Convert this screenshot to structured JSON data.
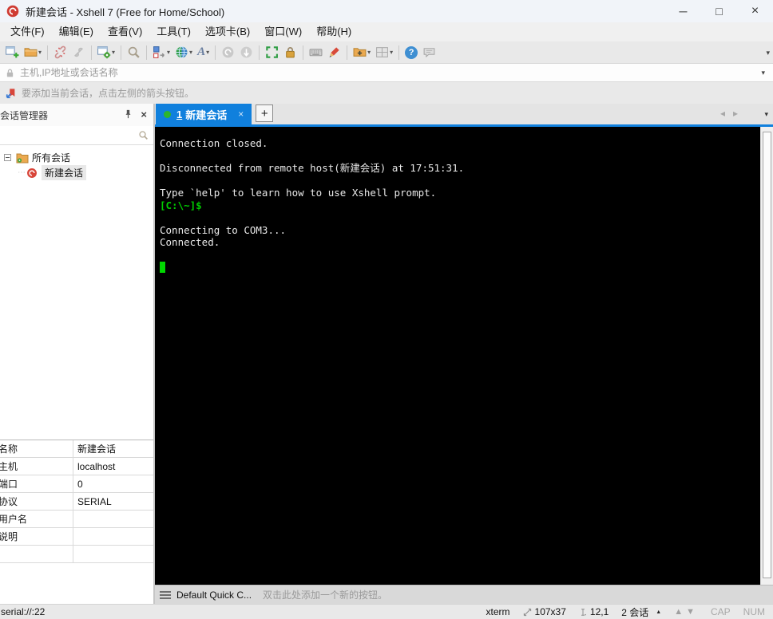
{
  "window": {
    "title": "新建会话 - Xshell 7 (Free for Home/School)",
    "controls": {
      "minimize": "─",
      "maximize": "□",
      "close": "×"
    }
  },
  "menu_bar": {
    "items": [
      "文件(F)",
      "编辑(E)",
      "查看(V)",
      "工具(T)",
      "选项卡(B)",
      "窗口(W)",
      "帮助(H)"
    ]
  },
  "toolbar": {
    "icons": [
      "new-session",
      "open-folder",
      "disconnect",
      "reconnect",
      "session-properties",
      "find",
      "compose",
      "web-browser",
      "font",
      "xshell",
      "xftp",
      "fullscreen",
      "lock-screen",
      "virtual-keyboard",
      "highlight",
      "new-session-folder",
      "tile-windows",
      "help",
      "feedback"
    ]
  },
  "address_bar": {
    "placeholder": "主机,IP地址或会话名称"
  },
  "info_bar": {
    "message": "要添加当前会话，点击左侧的箭头按钮。"
  },
  "session_manager": {
    "title": "会话管理器",
    "all_sessions_label": "所有会话",
    "session_label": "新建会话",
    "properties": [
      {
        "label": "名称",
        "value": "新建会话"
      },
      {
        "label": "主机",
        "value": "localhost"
      },
      {
        "label": "端口",
        "value": "0"
      },
      {
        "label": "协议",
        "value": "SERIAL"
      },
      {
        "label": "用户名",
        "value": ""
      },
      {
        "label": "说明",
        "value": ""
      }
    ]
  },
  "tab_bar": {
    "active_tab": {
      "number": "1",
      "label": "新建会话",
      "close": "×"
    },
    "new_tab_label": "+"
  },
  "terminal": {
    "background": "#000000",
    "text_color": "#e9e9e9",
    "prompt_color": "#00cc00",
    "cursor_color": "#00d800",
    "lines": [
      "Connection closed.",
      "",
      "Disconnected from remote host(新建会话) at 17:51:31.",
      "",
      "Type `help' to learn how to use Xshell prompt.",
      "[C:\\~]$",
      "",
      "Connecting to COM3...",
      "Connected.",
      ""
    ]
  },
  "quick_bar": {
    "set_label": "Default Quick C...",
    "hint": "双击此处添加一个新的按钮。"
  },
  "status_bar": {
    "connection": "serial://:22",
    "terminal_type": "xterm",
    "grid_size": "107x37",
    "cursor_position": "12,1",
    "sessions": "2 会话",
    "caps_lock": "CAP",
    "num_lock": "NUM"
  },
  "colors": {
    "accent": "#1080dd",
    "tab_dot_green": "#2db52d",
    "terminal_green": "#00cc00"
  }
}
